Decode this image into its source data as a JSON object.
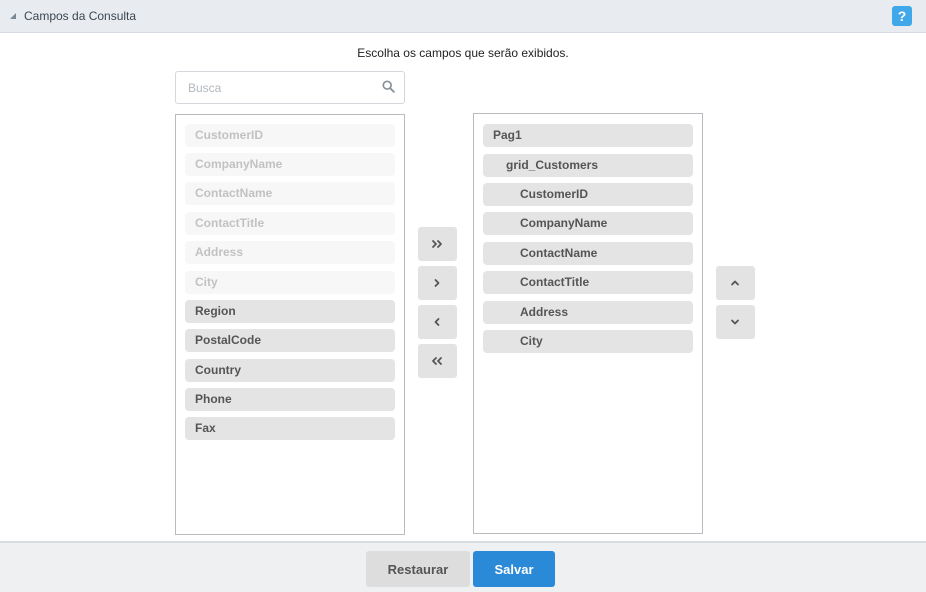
{
  "header": {
    "title": "Campos da Consulta",
    "help_label": "?"
  },
  "instruction": "Escolha os campos que serão exibidos.",
  "search": {
    "placeholder": "Busca",
    "value": ""
  },
  "available_fields": {
    "items": [
      {
        "label": "CustomerID",
        "state": "disabled"
      },
      {
        "label": "CompanyName",
        "state": "disabled"
      },
      {
        "label": "ContactName",
        "state": "disabled"
      },
      {
        "label": "ContactTitle",
        "state": "disabled"
      },
      {
        "label": "Address",
        "state": "disabled"
      },
      {
        "label": "City",
        "state": "disabled"
      },
      {
        "label": "Region",
        "state": "active"
      },
      {
        "label": "PostalCode",
        "state": "active"
      },
      {
        "label": "Country",
        "state": "active"
      },
      {
        "label": "Phone",
        "state": "active"
      },
      {
        "label": "Fax",
        "state": "active"
      }
    ]
  },
  "selected_fields": {
    "items": [
      {
        "label": "Pag1",
        "level": 0
      },
      {
        "label": "grid_Customers",
        "level": 1
      },
      {
        "label": "CustomerID",
        "level": 2
      },
      {
        "label": "CompanyName",
        "level": 2
      },
      {
        "label": "ContactName",
        "level": 2
      },
      {
        "label": "ContactTitle",
        "level": 2
      },
      {
        "label": "Address",
        "level": 2
      },
      {
        "label": "City",
        "level": 2
      }
    ]
  },
  "transfer_buttons": {
    "icons": [
      "double-chevron-right-icon",
      "chevron-right-icon",
      "chevron-left-icon",
      "double-chevron-left-icon"
    ]
  },
  "order_buttons": {
    "icons": [
      "chevron-up-icon",
      "chevron-down-icon"
    ]
  },
  "footer": {
    "restore_label": "Restaurar",
    "save_label": "Salvar"
  },
  "colors": {
    "header_bg": "#e8ecf1",
    "help_blue": "#3fa7ea",
    "save_blue": "#2a8ad8",
    "item_active": "#e4e4e4",
    "item_disabled": "#f7f7f7"
  }
}
